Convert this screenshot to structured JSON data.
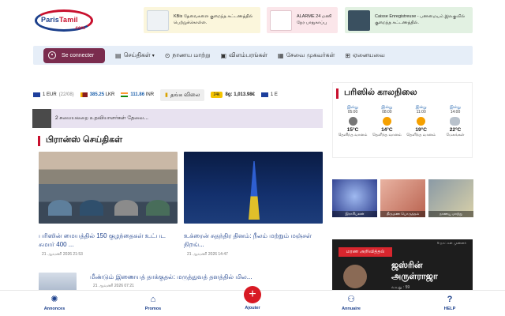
{
  "header": {
    "logo": {
      "brand": "ParisTamil",
      "brand_part1": "Paris",
      "brand_part2": "Tamil",
      "suffix": ".com"
    },
    "ads": [
      {
        "text": "KBis தேவைகளை குறைந்த கட்டணத்தில் பெற்றுக்கொள்ள.",
        "icon": "document-icon"
      },
      {
        "text": "ALARME 24 மணி நேர பாதுகாப்பு",
        "icon": "alarm-icon"
      },
      {
        "text": "Caisse Enregistreuse - பணமையம் இலகுவில் குறைந்த கட்டணத்தில்.",
        "icon": "register-icon"
      }
    ]
  },
  "nav": {
    "login_label": "Se connecter",
    "items": [
      {
        "label": "செய்திகள்",
        "icon": "news-icon",
        "has_caret": true
      },
      {
        "label": "நாணய மாற்று",
        "icon": "currency-icon"
      },
      {
        "label": "விளம்பரங்கள்",
        "icon": "ads-icon"
      },
      {
        "label": "சேவை முகவர்கள்",
        "icon": "services-icon"
      },
      {
        "label": "ஏனையவை",
        "icon": "grid-icon"
      }
    ]
  },
  "ticker": {
    "items": [
      {
        "label": "1 EUR",
        "note": "(22/08)"
      },
      {
        "value": "385.25",
        "unit": "LKR"
      },
      {
        "value": "111.86",
        "unit": "INR"
      }
    ],
    "gold_label": "தங்க விலை",
    "gold_badge": "24k",
    "gold_value": "8g: 1,013.98€",
    "tail": "1 E"
  },
  "alert": {
    "text": "2 சமையலறை உதவியாளர்கள் தேவை..."
  },
  "france_news": {
    "heading": "பிரான்ஸ் செய்திகள்",
    "articles": [
      {
        "title": "பரிஸின் மையத்தில் 150 குழந்தைகள் உட்பட சுமார் 400 ...",
        "date": "21 ஆவணி 2026 21:53"
      },
      {
        "title": "உக்ரைன் சுதந்திர தினம்: நீலம் மற்றும் மஞ்சள் நிறங்...",
        "date": "21 ஆவணி 2026 14:47"
      },
      {
        "title": "மீண்டும் இணையத் தாக்குதல்: மருத்துவத் தளத்தில் மில...",
        "date": "21 ஆவணி 2026 07:21"
      }
    ]
  },
  "weather": {
    "heading": "பரிஸில் காலநிலை",
    "columns": [
      {
        "day": "இன்று",
        "time": "05:00",
        "icon": "moon-icon",
        "temp": "15°C",
        "desc": "தெளிந்த வானம்"
      },
      {
        "day": "இன்று",
        "time": "08:00",
        "icon": "sun-icon",
        "temp": "14°C",
        "desc": "தெளிந்த வானம்"
      },
      {
        "day": "இன்று",
        "time": "11:00",
        "icon": "sun-icon",
        "temp": "19°C",
        "desc": "தெளிந்த வானம்"
      },
      {
        "day": "இன்று",
        "time": "14:00",
        "icon": "cloud-icon",
        "temp": "22°C",
        "desc": "மேகங்கள்"
      }
    ]
  },
  "tiles": [
    {
      "label": "இராசிபலன்"
    },
    {
      "label": "திருமண பொருத்தம்"
    },
    {
      "label": "நாணய மாற்று"
    }
  ],
  "obituary": {
    "tag": "மரண அறிவித்தல்",
    "ago": "5 நாட்கள் முன்னர்",
    "name_line1": "ஜஸ்ரின்",
    "name_line2": "அருள்ராஜா",
    "age": "வயது : 59"
  },
  "bottombar": {
    "items": [
      {
        "label": "Annonces",
        "icon": "megaphone-icon"
      },
      {
        "label": "Promos",
        "icon": "tag-icon"
      },
      {
        "label": "Ajouter",
        "icon": "plus-icon"
      },
      {
        "label": "Annuaire",
        "icon": "people-icon"
      },
      {
        "label": "HELP",
        "icon": "help-icon"
      }
    ]
  },
  "colors": {
    "accent_red": "#c8102e",
    "brand_blue": "#1b3f8b",
    "login_bg": "#7a2c4e",
    "nav_bg": "#e6eef8"
  }
}
